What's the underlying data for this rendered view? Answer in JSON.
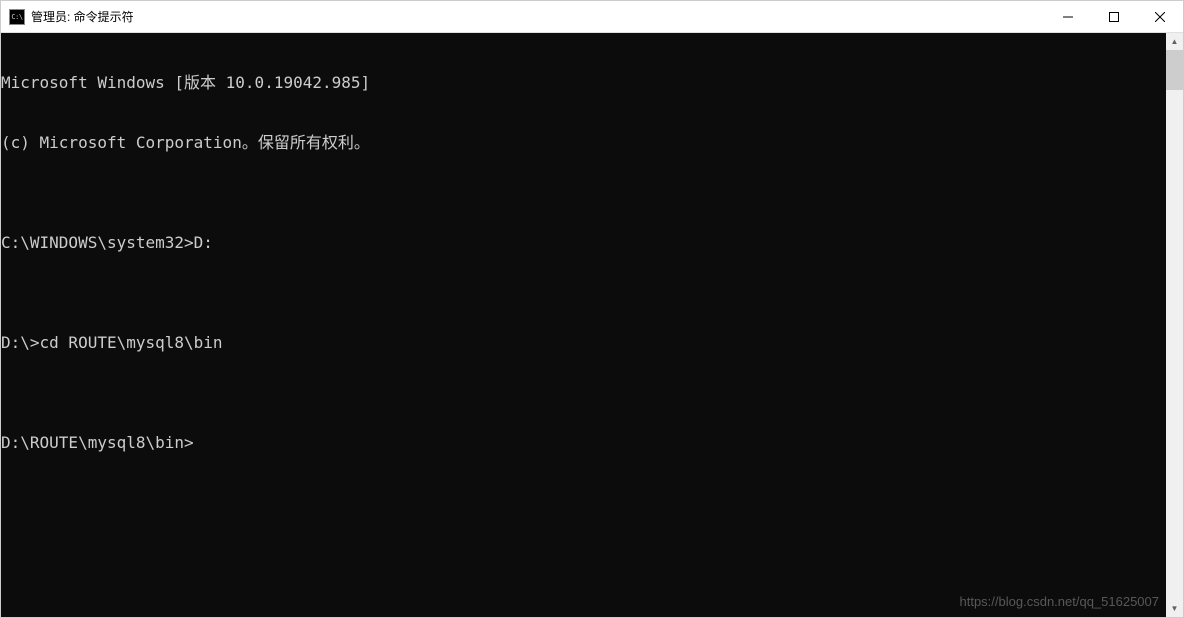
{
  "titlebar": {
    "icon_text": "C:\\",
    "title": "管理员: 命令提示符"
  },
  "terminal": {
    "lines": [
      "Microsoft Windows [版本 10.0.19042.985]",
      "(c) Microsoft Corporation。保留所有权利。",
      "",
      "C:\\WINDOWS\\system32>D:",
      "",
      "D:\\>cd ROUTE\\mysql8\\bin",
      "",
      "D:\\ROUTE\\mysql8\\bin>"
    ]
  },
  "watermark": "https://blog.csdn.net/qq_51625007"
}
